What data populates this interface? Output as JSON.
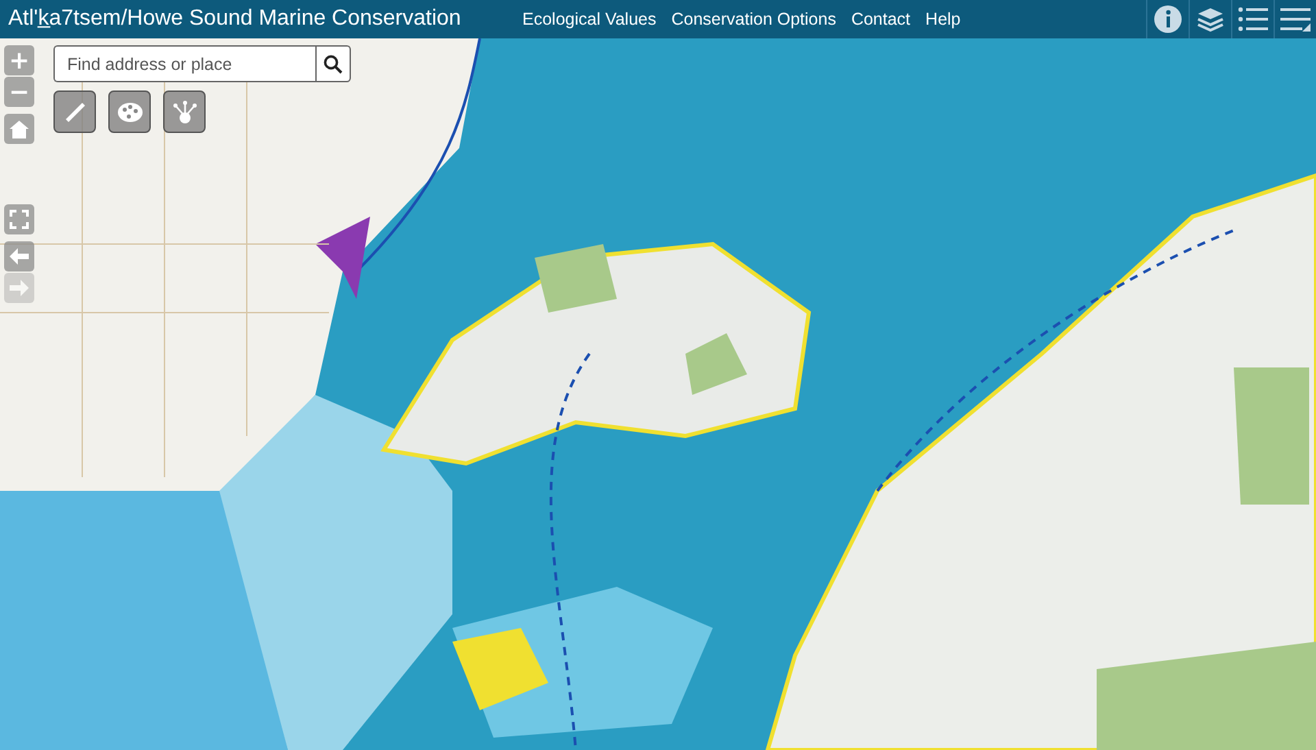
{
  "header": {
    "title": "Atl'k̲a7tsem/Howe Sound Marine Conservation",
    "nav": [
      "Ecological Values",
      "Conservation Options",
      "Contact",
      "Help"
    ]
  },
  "zoom": {
    "in": "+",
    "out": "−"
  },
  "search": {
    "placeholder": "Find address or place"
  },
  "history": [
    {
      "kind": "back",
      "disabled": false
    },
    {
      "kind": "forward",
      "disabled": true
    }
  ]
}
